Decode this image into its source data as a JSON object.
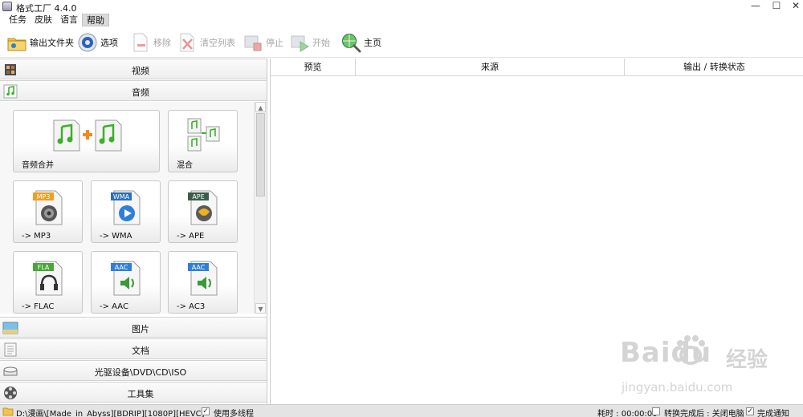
{
  "window": {
    "title": "格式工厂 4.4.0",
    "minimize": "—",
    "maximize": "☐",
    "close": "✕"
  },
  "menu": {
    "items": [
      "任务",
      "皮肤",
      "语言",
      "帮助"
    ]
  },
  "toolbar": {
    "output_folder": "输出文件夹",
    "options": "选项",
    "remove": "移除",
    "clear_list": "清空列表",
    "stop": "停止",
    "start": "开始",
    "home": "主页"
  },
  "categories": {
    "video": "视频",
    "audio": "音频",
    "picture": "图片",
    "document": "文档",
    "optical": "光驱设备\\DVD\\CD\\ISO",
    "tools": "工具集"
  },
  "audio_tiles": {
    "merge": "音频合并",
    "mix": "混合",
    "mp3": "-> MP3",
    "wma": "-> WMA",
    "ape": "-> APE",
    "flac": "-> FLAC",
    "aac": "-> AAC",
    "ac3": "-> AC3"
  },
  "badges": {
    "mp3": "MP3",
    "wma": "WMA",
    "ape": "APE",
    "flac": "FLA",
    "aac": "AAC",
    "ac3": "AAC"
  },
  "list_columns": {
    "preview": "预览",
    "source": "来源",
    "output_status": "输出 / 转换状态"
  },
  "statusbar": {
    "output_path": "D:\\漫画\\[Made_in_Abyss][BDRIP][1080P][HEVC]",
    "multithread_label": "使用多线程",
    "elapsed": "耗时 : 00:00:00",
    "shutdown_label": "转换完成后 : 关闭电脑",
    "notify_label": "完成通知",
    "checkmark": "✓"
  },
  "watermark": {
    "brand": "Baidu",
    "brand_cn": "经验",
    "url": "jingyan.baidu.com"
  },
  "colors": {
    "music_green": "#3fae2c",
    "merge_orange": "#f08a1c",
    "mp3_badge": "#f0a020",
    "wma_badge": "#2a6fb8",
    "ape_badge": "#3b5c4b",
    "flac_badge": "#4aa63a",
    "aac_badge": "#2f7fd8"
  }
}
